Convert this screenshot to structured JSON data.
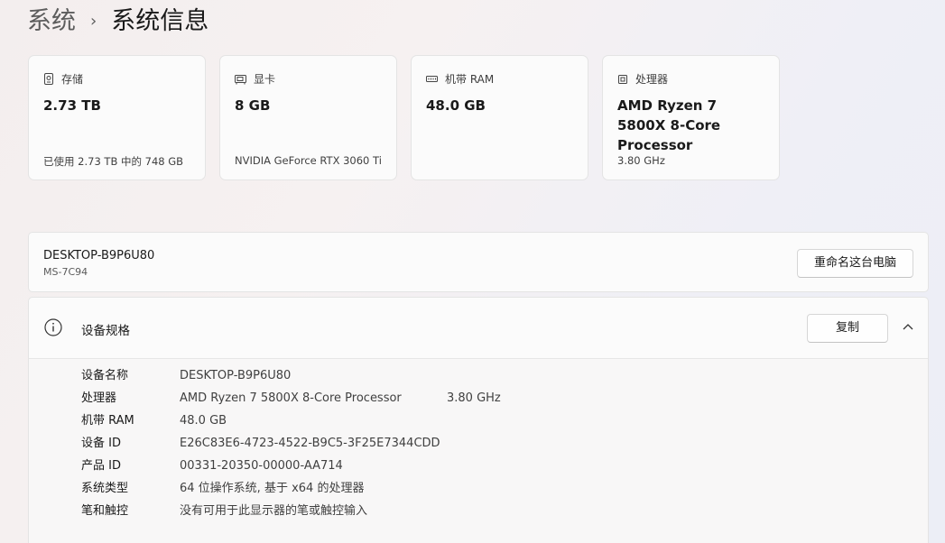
{
  "breadcrumb": {
    "parent": "系统",
    "separator": "›",
    "current": "系统信息"
  },
  "cards": [
    {
      "icon": "storage-icon",
      "title": "存储",
      "value": "2.73 TB",
      "subtitle": "已使用 2.73 TB 中的 748 GB"
    },
    {
      "icon": "gpu-icon",
      "title": "显卡",
      "value": "8 GB",
      "subtitle": "NVIDIA GeForce RTX 3060 Ti"
    },
    {
      "icon": "ram-icon",
      "title": "机带 RAM",
      "value": "48.0 GB",
      "subtitle": ""
    },
    {
      "icon": "cpu-icon",
      "title": "处理器",
      "value": "AMD Ryzen 7 5800X 8-Core Processor",
      "subtitle": "3.80 GHz"
    }
  ],
  "device": {
    "name": "DESKTOP-B9P6U80",
    "model": "MS-7C94",
    "rename_label": "重命名这台电脑"
  },
  "specs": {
    "title": "设备规格",
    "copy_label": "复制",
    "rows": [
      {
        "label": "设备名称",
        "value": "DESKTOP-B9P6U80",
        "extra": ""
      },
      {
        "label": "处理器",
        "value": "AMD Ryzen 7 5800X 8-Core Processor",
        "extra": "3.80 GHz"
      },
      {
        "label": "机带 RAM",
        "value": "48.0 GB",
        "extra": ""
      },
      {
        "label": "设备 ID",
        "value": "E26C83E6-4723-4522-B9C5-3F25E7344CDD",
        "extra": ""
      },
      {
        "label": "产品 ID",
        "value": "00331-20350-00000-AA714",
        "extra": ""
      },
      {
        "label": "系统类型",
        "value": "64 位操作系统, 基于 x64 的处理器",
        "extra": ""
      },
      {
        "label": "笔和触控",
        "value": "没有可用于此显示器的笔或触控输入",
        "extra": ""
      }
    ]
  }
}
